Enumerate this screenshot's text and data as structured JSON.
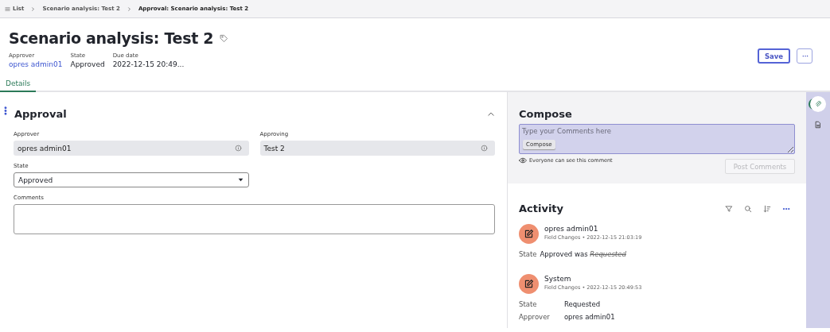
{
  "breadcrumb": [
    {
      "label": "List",
      "kind": "list"
    },
    {
      "label": "Scenario analysis: Test 2",
      "kind": "link"
    },
    {
      "label": "Approval: Scenario analysis: Test 2",
      "kind": "current"
    }
  ],
  "header": {
    "title": "Scenario analysis: Test 2",
    "fields": [
      {
        "label": "Approver",
        "value": "opres admin01",
        "kind": "link"
      },
      {
        "label": "State",
        "value": "Approved",
        "kind": "text"
      },
      {
        "label": "Due date",
        "value": "2022-12-15 20:49...",
        "kind": "text"
      }
    ],
    "buttons": [
      {
        "label": "Save",
        "kind": "primary"
      },
      {
        "label": "···",
        "kind": "more"
      }
    ]
  },
  "tabs": [
    {
      "label": "Details",
      "selected": true
    }
  ],
  "section": {
    "title": "Approval",
    "expanded": true,
    "fields": [
      {
        "label": "Approver",
        "value": "opres admin01",
        "kind": "readonly"
      },
      {
        "label": "Approving",
        "value": "Test 2",
        "kind": "readonly"
      },
      {
        "label": "State",
        "value": "Approved",
        "kind": "select"
      },
      {
        "label": "Comments",
        "kind": "textarea"
      }
    ]
  },
  "compose": {
    "title": "Compose",
    "placeholder": "Type your Comments here",
    "chip": "Compose",
    "visibility_note": "Everyone can see this comment",
    "button": {
      "label": "Post Comments",
      "disabled": true
    }
  },
  "activity": {
    "title": "Activity",
    "entries": [
      {
        "author": "opres admin01",
        "meta": "Field Changes • 2022-12-15 21:03:19",
        "changes": [
          {
            "field": "State",
            "value": "Approved",
            "joiner": "was",
            "previous": "Requested"
          }
        ]
      },
      {
        "author": "System",
        "meta": "Field Changes • 2022-12-15 20:49:53",
        "changes": [
          {
            "field": "State",
            "value": "Requested"
          },
          {
            "field": "Approver",
            "value": "opres admin01"
          }
        ]
      }
    ]
  },
  "rail": [
    {
      "kind": "attachment",
      "selected": true
    },
    {
      "kind": "document",
      "selected": false
    }
  ]
}
